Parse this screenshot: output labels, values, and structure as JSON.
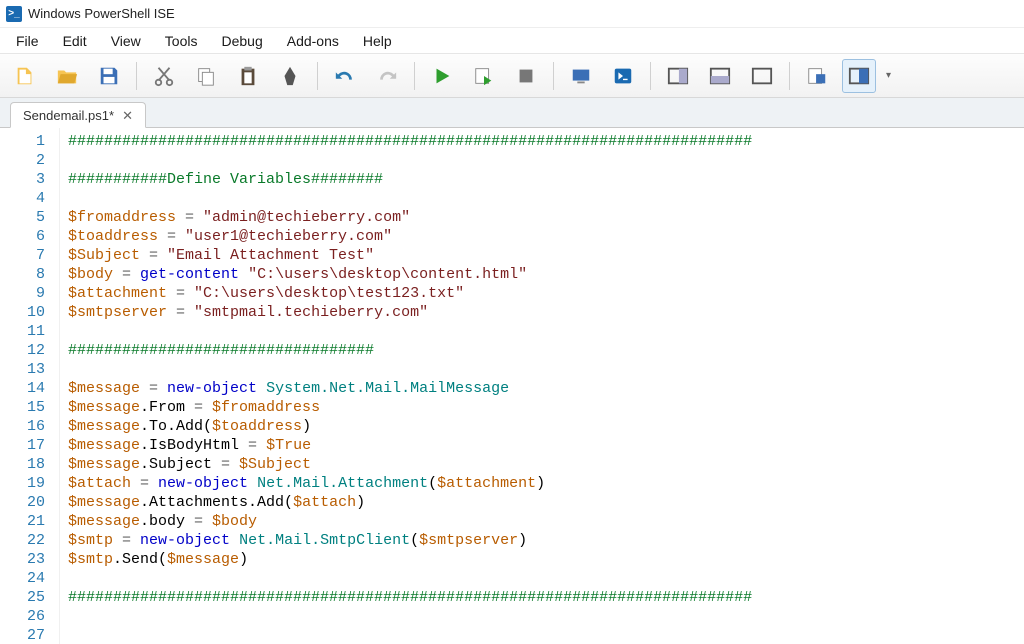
{
  "window": {
    "title": "Windows PowerShell ISE"
  },
  "menu": [
    "File",
    "Edit",
    "View",
    "Tools",
    "Debug",
    "Add-ons",
    "Help"
  ],
  "toolbar_icons": [
    "new-icon",
    "open-icon",
    "save-icon",
    "cut-icon",
    "copy-icon",
    "paste-icon",
    "clear-icon",
    "undo-icon",
    "redo-icon",
    "run-icon",
    "run-selection-icon",
    "stop-icon",
    "remote-icon",
    "powershell-icon",
    "pane-right-icon",
    "pane-bottom-icon",
    "pane-full-icon",
    "command-addon-icon",
    "show-command-icon"
  ],
  "tab": {
    "label": "Sendemail.ps1*"
  },
  "code": {
    "lines": [
      [
        [
          "comment",
          "############################################################################"
        ]
      ],
      [],
      [
        [
          "comment",
          "###########Define Variables########"
        ]
      ],
      [],
      [
        [
          "var",
          "$fromaddress"
        ],
        [
          "op",
          " = "
        ],
        [
          "str",
          "\"admin@techieberry.com\""
        ]
      ],
      [
        [
          "var",
          "$toaddress"
        ],
        [
          "op",
          " = "
        ],
        [
          "str",
          "\"user1@techieberry.com\""
        ]
      ],
      [
        [
          "var",
          "$Subject"
        ],
        [
          "op",
          " = "
        ],
        [
          "str",
          "\"Email Attachment Test\""
        ]
      ],
      [
        [
          "var",
          "$body"
        ],
        [
          "op",
          " = "
        ],
        [
          "kw",
          "get-content"
        ],
        [
          "op",
          " "
        ],
        [
          "str",
          "\"C:\\users\\desktop\\content.html\""
        ]
      ],
      [
        [
          "var",
          "$attachment"
        ],
        [
          "op",
          " = "
        ],
        [
          "str",
          "\"C:\\users\\desktop\\test123.txt\""
        ]
      ],
      [
        [
          "var",
          "$smtpserver"
        ],
        [
          "op",
          " = "
        ],
        [
          "str",
          "\"smtpmail.techieberry.com\""
        ]
      ],
      [],
      [
        [
          "comment",
          "##################################"
        ]
      ],
      [],
      [
        [
          "var",
          "$message"
        ],
        [
          "op",
          " = "
        ],
        [
          "kw",
          "new-object"
        ],
        [
          "op",
          " "
        ],
        [
          "type",
          "System.Net.Mail.MailMessage"
        ]
      ],
      [
        [
          "var",
          "$message"
        ],
        [
          "mem",
          ".From"
        ],
        [
          "op",
          " = "
        ],
        [
          "var",
          "$fromaddress"
        ]
      ],
      [
        [
          "var",
          "$message"
        ],
        [
          "mem",
          ".To.Add"
        ],
        [
          "lp",
          "("
        ],
        [
          "var",
          "$toaddress"
        ],
        [
          "lp",
          ")"
        ]
      ],
      [
        [
          "var",
          "$message"
        ],
        [
          "mem",
          ".IsBodyHtml"
        ],
        [
          "op",
          " = "
        ],
        [
          "var",
          "$True"
        ]
      ],
      [
        [
          "var",
          "$message"
        ],
        [
          "mem",
          ".Subject"
        ],
        [
          "op",
          " = "
        ],
        [
          "var",
          "$Subject"
        ]
      ],
      [
        [
          "var",
          "$attach"
        ],
        [
          "op",
          " = "
        ],
        [
          "kw",
          "new-object"
        ],
        [
          "op",
          " "
        ],
        [
          "type",
          "Net.Mail.Attachment"
        ],
        [
          "lp",
          "("
        ],
        [
          "var",
          "$attachment"
        ],
        [
          "lp",
          ")"
        ]
      ],
      [
        [
          "var",
          "$message"
        ],
        [
          "mem",
          ".Attachments.Add"
        ],
        [
          "lp",
          "("
        ],
        [
          "var",
          "$attach"
        ],
        [
          "lp",
          ")"
        ]
      ],
      [
        [
          "var",
          "$message"
        ],
        [
          "mem",
          ".body"
        ],
        [
          "op",
          " = "
        ],
        [
          "var",
          "$body"
        ]
      ],
      [
        [
          "var",
          "$smtp"
        ],
        [
          "op",
          " = "
        ],
        [
          "kw",
          "new-object"
        ],
        [
          "op",
          " "
        ],
        [
          "type",
          "Net.Mail.SmtpClient"
        ],
        [
          "lp",
          "("
        ],
        [
          "var",
          "$smtpserver"
        ],
        [
          "lp",
          ")"
        ]
      ],
      [
        [
          "var",
          "$smtp"
        ],
        [
          "mem",
          ".Send"
        ],
        [
          "lp",
          "("
        ],
        [
          "var",
          "$message"
        ],
        [
          "lp",
          ")"
        ]
      ],
      [],
      [
        [
          "comment",
          "############################################################################"
        ]
      ],
      [],
      []
    ]
  }
}
